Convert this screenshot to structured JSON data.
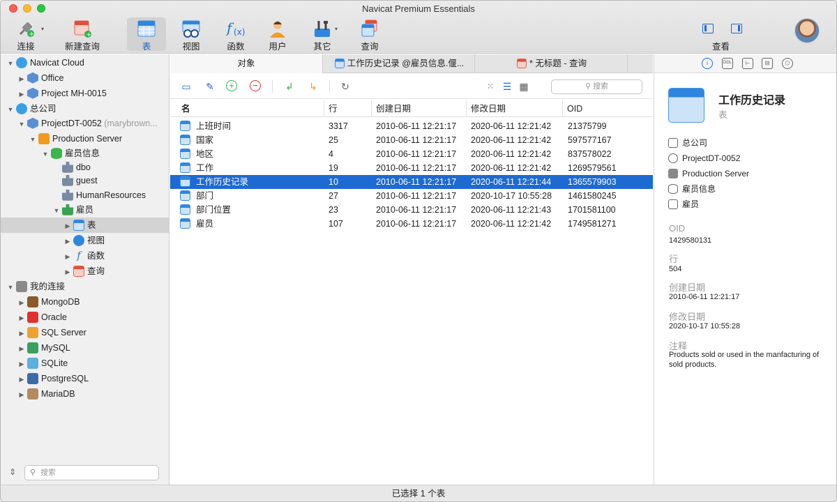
{
  "window": {
    "title": "Navicat Premium Essentials"
  },
  "toolbar": {
    "connect": "连接",
    "new_query": "新建查询",
    "table": "表",
    "view": "视图",
    "function": "函数",
    "user": "用户",
    "other": "其它",
    "query": "查询",
    "view_toggle": "查看"
  },
  "sidebar": {
    "navicat_cloud": "Navicat Cloud",
    "office": "Office",
    "project_mh": "Project MH-0015",
    "head_office": "总公司",
    "project_dt": "ProjectDT-0052",
    "project_dt_owner": "(marybrown...",
    "production_server": "Production Server",
    "employee_info": "雇员信息",
    "dbo": "dbo",
    "guest": "guest",
    "human_resources": "HumanResources",
    "employee": "雇员",
    "tables": "表",
    "views": "视图",
    "functions": "函数",
    "queries": "查询",
    "my_connections": "我的连接",
    "mongodb": "MongoDB",
    "oracle": "Oracle",
    "sqlserver": "SQL Server",
    "mysql": "MySQL",
    "sqlite": "SQLite",
    "postgresql": "PostgreSQL",
    "mariadb": "MariaDB",
    "search_placeholder": "搜索"
  },
  "tabs": {
    "objects": "对象",
    "work_history": "工作历史记录 @雇员信息.偃...",
    "untitled_query": "* 无标题 - 查询"
  },
  "main": {
    "search_placeholder": "搜索",
    "columns": {
      "name": "名",
      "rows": "行",
      "created": "创建日期",
      "modified": "修改日期",
      "oid": "OID"
    },
    "rows": [
      {
        "name": "上班时间",
        "rows": "3317",
        "created": "2010-06-11 12:21:17",
        "modified": "2020-06-11 12:21:42",
        "oid": "21375799"
      },
      {
        "name": "国家",
        "rows": "25",
        "created": "2010-06-11 12:21:17",
        "modified": "2020-06-11 12:21:42",
        "oid": "597577167"
      },
      {
        "name": "地区",
        "rows": "4",
        "created": "2010-06-11 12:21:17",
        "modified": "2020-06-11 12:21:42",
        "oid": "837578022"
      },
      {
        "name": "工作",
        "rows": "19",
        "created": "2010-06-11 12:21:17",
        "modified": "2020-06-11 12:21:42",
        "oid": "1269579561"
      },
      {
        "name": "工作历史记录",
        "rows": "10",
        "created": "2010-06-11 12:21:17",
        "modified": "2020-06-11 12:21:44",
        "oid": "1365579903"
      },
      {
        "name": "部门",
        "rows": "27",
        "created": "2010-06-11 12:21:17",
        "modified": "2020-10-17 10:55:28",
        "oid": "1461580245"
      },
      {
        "name": "部门位置",
        "rows": "23",
        "created": "2010-06-11 12:21:17",
        "modified": "2020-06-11 12:21:43",
        "oid": "1701581100"
      },
      {
        "name": "雇员",
        "rows": "107",
        "created": "2010-06-11 12:21:17",
        "modified": "2020-06-11 12:21:42",
        "oid": "1749581271"
      }
    ]
  },
  "inspector": {
    "title": "工作历史记录",
    "subtitle": "表",
    "hierarchy": [
      "总公司",
      "ProjectDT-0052",
      "Production Server",
      "雇员信息",
      "雇员"
    ],
    "oid_label": "OID",
    "oid": "1429580131",
    "rows_label": "行",
    "rows": "504",
    "created_label": "创建日期",
    "created": "2010-06-11 12:21:17",
    "modified_label": "修改日期",
    "modified": "2020-10-17 10:55:28",
    "comment_label": "注释",
    "comment": "Products sold or used in the manfacturing of sold products."
  },
  "status": {
    "text": "已选择 1 个表"
  },
  "colors": {
    "accent": "#1d6ad2",
    "selection": "#1d6ad2"
  },
  "icons": [
    "plug-icon",
    "new-query-icon",
    "table-icon",
    "view-icon",
    "function-icon",
    "user-icon",
    "tools-icon",
    "query-icon",
    "panel-left-icon",
    "panel-right-icon",
    "avatar",
    "open-folder-icon",
    "pencil-icon",
    "plus-circle-icon",
    "minus-circle-icon",
    "import-icon",
    "export-icon",
    "refresh-icon",
    "grid-view-icon",
    "list-view-icon",
    "detail-view-icon",
    "search-icon",
    "info-icon",
    "ddl-icon",
    "dependency-icon",
    "erd-icon",
    "hex-icon"
  ]
}
